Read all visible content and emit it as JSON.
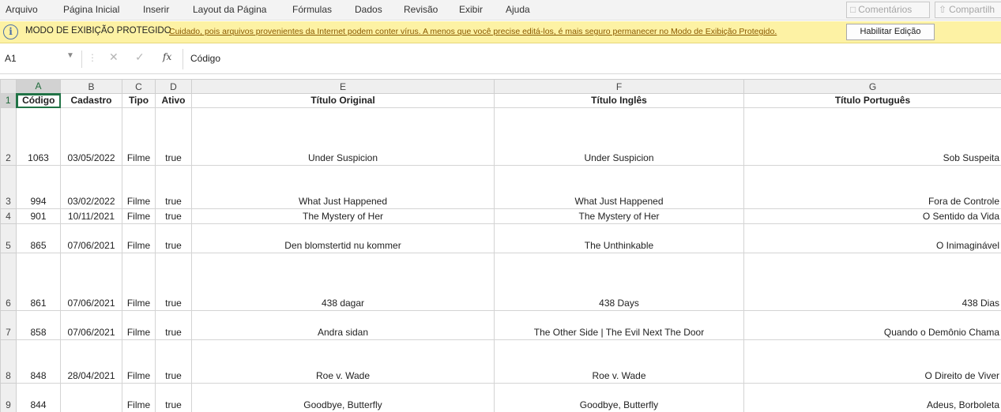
{
  "menu": {
    "tabs": [
      "Arquivo",
      "Página Inicial",
      "Inserir",
      "Layout da Página",
      "Fórmulas",
      "Dados",
      "Revisão",
      "Exibir",
      "Ajuda"
    ],
    "comments_label": "Comentários",
    "share_label": "Compartilh"
  },
  "protected_view": {
    "title": "MODO DE EXIBIÇÃO PROTEGIDO",
    "message": "Cuidado, pois arquivos provenientes da Internet podem conter vírus. A menos que você precise editá-los, é mais seguro permanecer no Modo de Exibição Protegido.",
    "enable_button": "Habilitar Edição"
  },
  "formula_bar": {
    "name_box": "A1",
    "fx": "fx",
    "content": "Código"
  },
  "colors": {
    "accent": "#217346",
    "warning_bar": "#FDF2A4",
    "link_text": "#8A5A00"
  },
  "sheet": {
    "columns": [
      "A",
      "B",
      "C",
      "D",
      "E",
      "F",
      "G"
    ],
    "selected_cell": "A1",
    "header_row": {
      "num": "1",
      "cells": [
        "Código",
        "Cadastro",
        "Tipo",
        "Ativo",
        "Título Original",
        "Título Inglês",
        "Título Português"
      ]
    },
    "rows": [
      {
        "num": "2",
        "codigo": "1063",
        "cadastro": "03/05/2022",
        "tipo": "Filme",
        "ativo": "true",
        "original": "Under Suspicion",
        "ingles": "Under Suspicion",
        "portugues": "Sob Suspeita"
      },
      {
        "num": "3",
        "codigo": "994",
        "cadastro": "03/02/2022",
        "tipo": "Filme",
        "ativo": "true",
        "original": "What Just Happened",
        "ingles": "What Just Happened",
        "portugues": "Fora de Controle"
      },
      {
        "num": "4",
        "codigo": "901",
        "cadastro": "10/11/2021",
        "tipo": "Filme",
        "ativo": "true",
        "original": "The Mystery of Her",
        "ingles": "The Mystery of Her",
        "portugues": "O Sentido da Vida"
      },
      {
        "num": "5",
        "codigo": "865",
        "cadastro": "07/06/2021",
        "tipo": "Filme",
        "ativo": "true",
        "original": "Den blomstertid nu kommer",
        "ingles": "The Unthinkable",
        "portugues": "O Inimaginável"
      },
      {
        "num": "6",
        "codigo": "861",
        "cadastro": "07/06/2021",
        "tipo": "Filme",
        "ativo": "true",
        "original": "438 dagar",
        "ingles": "438 Days",
        "portugues": "438 Dias"
      },
      {
        "num": "7",
        "codigo": "858",
        "cadastro": "07/06/2021",
        "tipo": "Filme",
        "ativo": "true",
        "original": "Andra sidan",
        "ingles": "The Other Side | The Evil Next The Door",
        "portugues": "Quando o Demônio Chama"
      },
      {
        "num": "8",
        "codigo": "848",
        "cadastro": "28/04/2021",
        "tipo": "Filme",
        "ativo": "true",
        "original": "Roe v. Wade",
        "ingles": "Roe v. Wade",
        "portugues": "O Direito de Viver"
      },
      {
        "num": "9",
        "codigo": "844",
        "cadastro": "",
        "tipo": "Filme",
        "ativo": "true",
        "original": "Goodbye, Butterfly",
        "ingles": "Goodbye, Butterfly",
        "portugues": "Adeus, Borboleta"
      }
    ]
  }
}
